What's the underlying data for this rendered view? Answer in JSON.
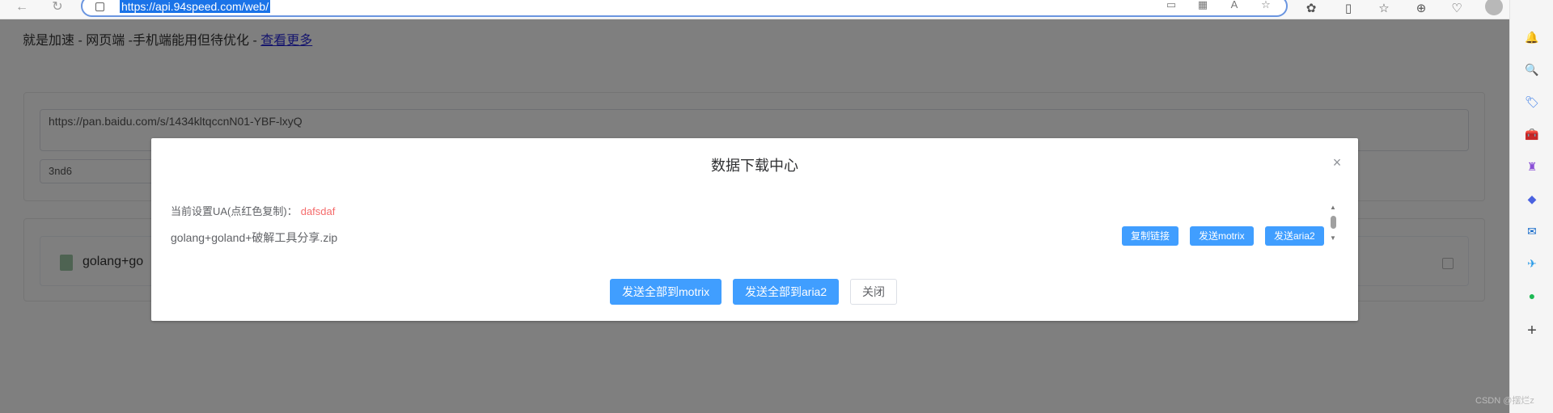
{
  "browser": {
    "url": "https://api.94speed.com/web/",
    "back_icon": "←",
    "refresh_icon": "↻",
    "toolbar_icons": [
      "read-aloud-icon",
      "qr-code-icon",
      "text-size-icon",
      "star-icon",
      "extensions-icon",
      "split-screen-icon",
      "favorites-icon",
      "collections-icon",
      "browser-essentials-icon"
    ],
    "more_icon": "···"
  },
  "page": {
    "header_text": "就是加速 - 网页端 -手机端能用但待优化 -",
    "header_link": "查看更多",
    "share_link": "https://pan.baidu.com/s/1434kltqccnN01-YBF-lxyQ",
    "extract_code": "3nd6",
    "file_name_partial": "golang+go"
  },
  "sidebar": {
    "icons": [
      {
        "name": "bell-icon",
        "glyph": "🔔",
        "color": "#2f6fe4"
      },
      {
        "name": "search-icon",
        "glyph": "🔍",
        "color": "#2f6fe4"
      },
      {
        "name": "tag-icon",
        "glyph": "🏷",
        "color": "#3b7de8"
      },
      {
        "name": "toolbox-icon",
        "glyph": "🧰",
        "color": "#d84a2a"
      },
      {
        "name": "chess-icon",
        "glyph": "♜",
        "color": "#8a4fd6"
      },
      {
        "name": "copilot-icon",
        "glyph": "◆",
        "color": "#4a62e0"
      },
      {
        "name": "outlook-icon",
        "glyph": "✉",
        "color": "#0a64c8"
      },
      {
        "name": "send-icon",
        "glyph": "✈",
        "color": "#2a9be8"
      },
      {
        "name": "spotify-icon",
        "glyph": "●",
        "color": "#1db954"
      },
      {
        "name": "add-icon",
        "glyph": "+",
        "color": "#444444"
      }
    ]
  },
  "modal": {
    "title": "数据下载中心",
    "close_glyph": "×",
    "ua_label": "当前设置UA(点红色复制)：",
    "ua_value": "dafsdaf",
    "file_name": "golang+goland+破解工具分享.zip",
    "copy_link_label": "复制链接",
    "send_motrix_label": "发送motrix",
    "send_aria2_label": "发送aria2",
    "send_all_motrix_label": "发送全部到motrix",
    "send_all_aria2_label": "发送全部到aria2",
    "close_label": "关闭"
  },
  "watermark": "CSDN @摆烂z"
}
